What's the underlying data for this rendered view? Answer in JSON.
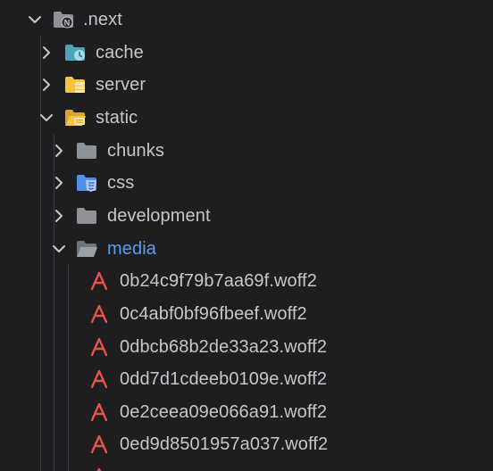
{
  "explorer": {
    "next_folder": {
      "label": ".next",
      "badge": "N"
    },
    "cache_folder": {
      "label": "cache"
    },
    "server_folder": {
      "label": "server"
    },
    "static_folder": {
      "label": "static"
    },
    "chunks_folder": {
      "label": "chunks"
    },
    "css_folder": {
      "label": "css"
    },
    "development_folder": {
      "label": "development"
    },
    "media_folder": {
      "label": "media"
    },
    "media_files": [
      {
        "label": "0b24c9f79b7aa69f.woff2"
      },
      {
        "label": "0c4abf0bf96fbeef.woff2"
      },
      {
        "label": "0dbcb68b2de33a23.woff2"
      },
      {
        "label": "0dd7d1cdeeb0109e.woff2"
      },
      {
        "label": "0e2ceea09e066a91.woff2"
      },
      {
        "label": "0ed9d8501957a037.woff2"
      }
    ]
  },
  "colors": {
    "background": "#1e1e20",
    "text": "#c7c7ca",
    "active_text": "#5b9bf5",
    "font_icon": "#e5534b",
    "folder_grey": "#8d9399",
    "folder_yellow": "#f5c242",
    "folder_teal": "#4fa3b8"
  }
}
